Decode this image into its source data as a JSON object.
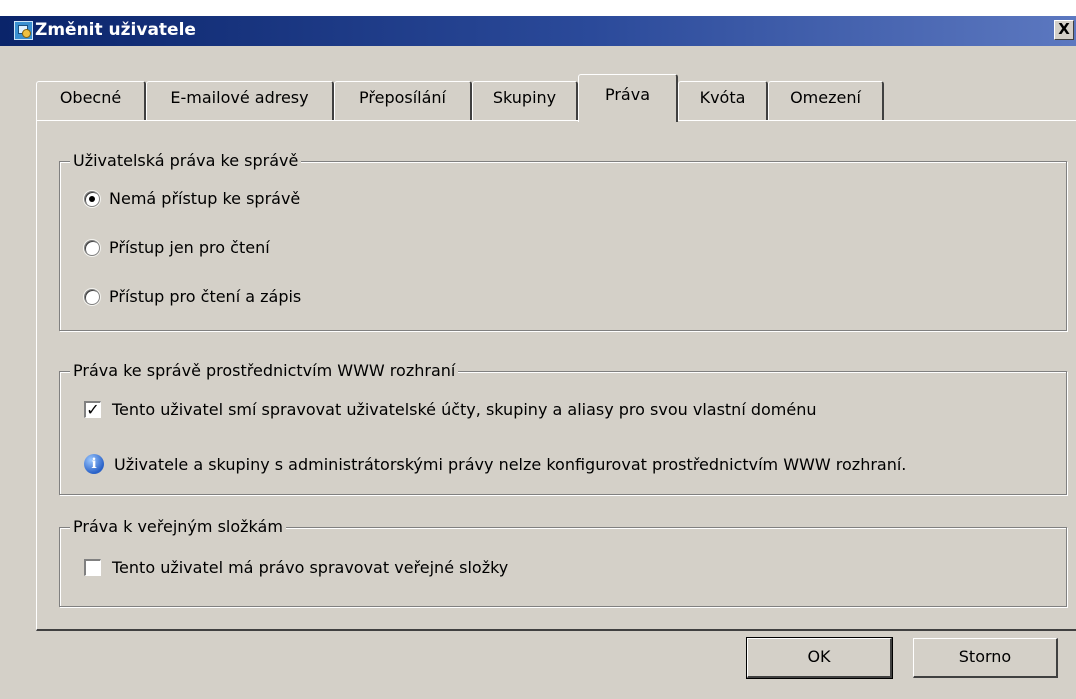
{
  "window": {
    "title": "Změnit uživatele",
    "close_label": "X"
  },
  "tabs": [
    {
      "label": "Obecné"
    },
    {
      "label": "E-mailové adresy"
    },
    {
      "label": "Přeposílání"
    },
    {
      "label": "Skupiny"
    },
    {
      "label": "Práva",
      "active": true
    },
    {
      "label": "Kvóta"
    },
    {
      "label": "Omezení"
    }
  ],
  "admin_rights": {
    "legend": "Uživatelská práva ke správě",
    "options": [
      {
        "label": "Nemá přístup ke správě",
        "selected": true
      },
      {
        "label": "Přístup jen pro čtení",
        "selected": false
      },
      {
        "label": "Přístup pro čtení a zápis",
        "selected": false
      }
    ]
  },
  "web_admin": {
    "legend": "Práva ke správě prostřednictvím WWW rozhraní",
    "checkbox_label": "Tento uživatel smí spravovat uživatelské účty, skupiny a aliasy pro svou vlastní doménu",
    "checked": true,
    "info_text": "Uživatele a skupiny s administrátorskými právy nelze konfigurovat prostřednictvím WWW rozhraní."
  },
  "public_folders": {
    "legend": "Práva k veřejným složkám",
    "checkbox_label": "Tento uživatel má právo spravovat veřejné složky",
    "checked": false
  },
  "buttons": {
    "ok": "OK",
    "cancel": "Storno"
  }
}
